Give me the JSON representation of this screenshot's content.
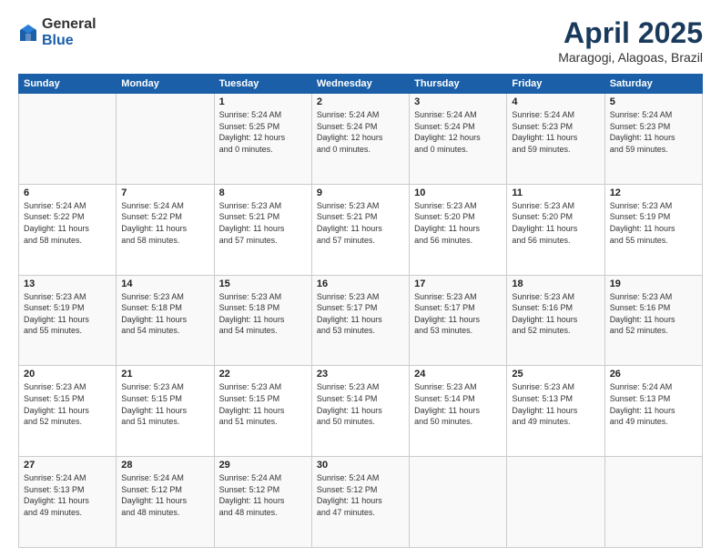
{
  "header": {
    "logo_general": "General",
    "logo_blue": "Blue",
    "title": "April 2025",
    "subtitle": "Maragogi, Alagoas, Brazil"
  },
  "weekdays": [
    "Sunday",
    "Monday",
    "Tuesday",
    "Wednesday",
    "Thursday",
    "Friday",
    "Saturday"
  ],
  "weeks": [
    [
      {
        "day": "",
        "detail": ""
      },
      {
        "day": "",
        "detail": ""
      },
      {
        "day": "1",
        "detail": "Sunrise: 5:24 AM\nSunset: 5:25 PM\nDaylight: 12 hours\nand 0 minutes."
      },
      {
        "day": "2",
        "detail": "Sunrise: 5:24 AM\nSunset: 5:24 PM\nDaylight: 12 hours\nand 0 minutes."
      },
      {
        "day": "3",
        "detail": "Sunrise: 5:24 AM\nSunset: 5:24 PM\nDaylight: 12 hours\nand 0 minutes."
      },
      {
        "day": "4",
        "detail": "Sunrise: 5:24 AM\nSunset: 5:23 PM\nDaylight: 11 hours\nand 59 minutes."
      },
      {
        "day": "5",
        "detail": "Sunrise: 5:24 AM\nSunset: 5:23 PM\nDaylight: 11 hours\nand 59 minutes."
      }
    ],
    [
      {
        "day": "6",
        "detail": "Sunrise: 5:24 AM\nSunset: 5:22 PM\nDaylight: 11 hours\nand 58 minutes."
      },
      {
        "day": "7",
        "detail": "Sunrise: 5:24 AM\nSunset: 5:22 PM\nDaylight: 11 hours\nand 58 minutes."
      },
      {
        "day": "8",
        "detail": "Sunrise: 5:23 AM\nSunset: 5:21 PM\nDaylight: 11 hours\nand 57 minutes."
      },
      {
        "day": "9",
        "detail": "Sunrise: 5:23 AM\nSunset: 5:21 PM\nDaylight: 11 hours\nand 57 minutes."
      },
      {
        "day": "10",
        "detail": "Sunrise: 5:23 AM\nSunset: 5:20 PM\nDaylight: 11 hours\nand 56 minutes."
      },
      {
        "day": "11",
        "detail": "Sunrise: 5:23 AM\nSunset: 5:20 PM\nDaylight: 11 hours\nand 56 minutes."
      },
      {
        "day": "12",
        "detail": "Sunrise: 5:23 AM\nSunset: 5:19 PM\nDaylight: 11 hours\nand 55 minutes."
      }
    ],
    [
      {
        "day": "13",
        "detail": "Sunrise: 5:23 AM\nSunset: 5:19 PM\nDaylight: 11 hours\nand 55 minutes."
      },
      {
        "day": "14",
        "detail": "Sunrise: 5:23 AM\nSunset: 5:18 PM\nDaylight: 11 hours\nand 54 minutes."
      },
      {
        "day": "15",
        "detail": "Sunrise: 5:23 AM\nSunset: 5:18 PM\nDaylight: 11 hours\nand 54 minutes."
      },
      {
        "day": "16",
        "detail": "Sunrise: 5:23 AM\nSunset: 5:17 PM\nDaylight: 11 hours\nand 53 minutes."
      },
      {
        "day": "17",
        "detail": "Sunrise: 5:23 AM\nSunset: 5:17 PM\nDaylight: 11 hours\nand 53 minutes."
      },
      {
        "day": "18",
        "detail": "Sunrise: 5:23 AM\nSunset: 5:16 PM\nDaylight: 11 hours\nand 52 minutes."
      },
      {
        "day": "19",
        "detail": "Sunrise: 5:23 AM\nSunset: 5:16 PM\nDaylight: 11 hours\nand 52 minutes."
      }
    ],
    [
      {
        "day": "20",
        "detail": "Sunrise: 5:23 AM\nSunset: 5:15 PM\nDaylight: 11 hours\nand 52 minutes."
      },
      {
        "day": "21",
        "detail": "Sunrise: 5:23 AM\nSunset: 5:15 PM\nDaylight: 11 hours\nand 51 minutes."
      },
      {
        "day": "22",
        "detail": "Sunrise: 5:23 AM\nSunset: 5:15 PM\nDaylight: 11 hours\nand 51 minutes."
      },
      {
        "day": "23",
        "detail": "Sunrise: 5:23 AM\nSunset: 5:14 PM\nDaylight: 11 hours\nand 50 minutes."
      },
      {
        "day": "24",
        "detail": "Sunrise: 5:23 AM\nSunset: 5:14 PM\nDaylight: 11 hours\nand 50 minutes."
      },
      {
        "day": "25",
        "detail": "Sunrise: 5:23 AM\nSunset: 5:13 PM\nDaylight: 11 hours\nand 49 minutes."
      },
      {
        "day": "26",
        "detail": "Sunrise: 5:24 AM\nSunset: 5:13 PM\nDaylight: 11 hours\nand 49 minutes."
      }
    ],
    [
      {
        "day": "27",
        "detail": "Sunrise: 5:24 AM\nSunset: 5:13 PM\nDaylight: 11 hours\nand 49 minutes."
      },
      {
        "day": "28",
        "detail": "Sunrise: 5:24 AM\nSunset: 5:12 PM\nDaylight: 11 hours\nand 48 minutes."
      },
      {
        "day": "29",
        "detail": "Sunrise: 5:24 AM\nSunset: 5:12 PM\nDaylight: 11 hours\nand 48 minutes."
      },
      {
        "day": "30",
        "detail": "Sunrise: 5:24 AM\nSunset: 5:12 PM\nDaylight: 11 hours\nand 47 minutes."
      },
      {
        "day": "",
        "detail": ""
      },
      {
        "day": "",
        "detail": ""
      },
      {
        "day": "",
        "detail": ""
      }
    ]
  ]
}
